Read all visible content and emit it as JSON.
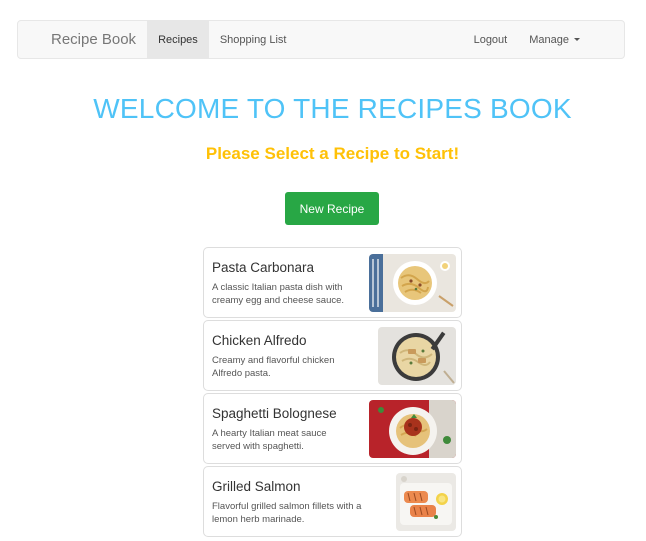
{
  "navbar": {
    "brand": "Recipe Book",
    "items": [
      {
        "label": "Recipes",
        "active": true
      },
      {
        "label": "Shopping List",
        "active": false
      }
    ],
    "right_items": [
      {
        "label": "Logout"
      },
      {
        "label": "Manage"
      }
    ]
  },
  "main": {
    "title": "WELCOME TO THE RECIPES BOOK",
    "subtitle": "Please Select a Recipe to Start!",
    "new_recipe_label": "New Recipe"
  },
  "recipes": [
    {
      "name": "Pasta Carbonara",
      "description_line1": "A classic Italian pasta dish with",
      "description_line2": "creamy egg and cheese sauce."
    },
    {
      "name": "Chicken Alfredo",
      "description_line1": "Creamy and flavorful chicken",
      "description_line2": "Alfredo pasta."
    },
    {
      "name": "Spaghetti Bolognese",
      "description_line1": "A hearty Italian meat sauce",
      "description_line2": "served with spaghetti."
    },
    {
      "name": "Grilled Salmon",
      "description_line1": "Flavorful grilled salmon fillets with a",
      "description_line2": "lemon herb marinade."
    }
  ],
  "colors": {
    "title": "#4fc3f7",
    "subtitle": "#ffc107",
    "button": "#28a745"
  }
}
